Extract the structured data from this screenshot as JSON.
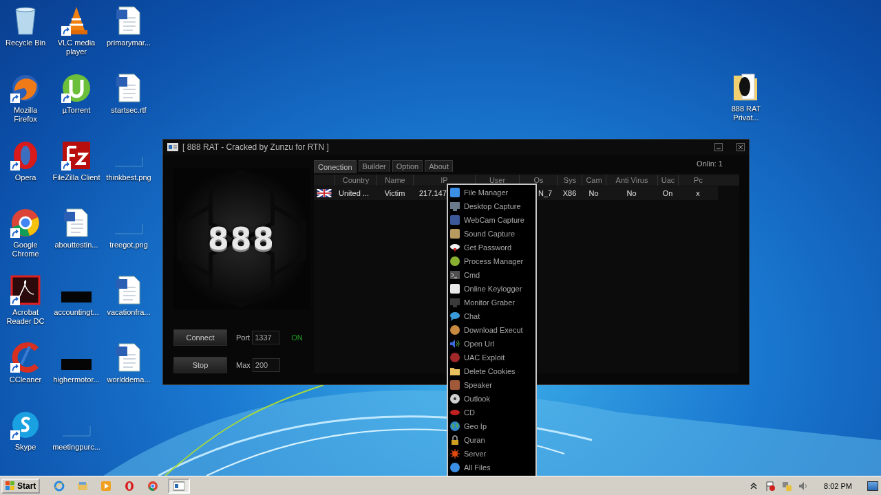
{
  "desktop_icons": [
    {
      "label": "Recycle Bin",
      "kind": "recycle",
      "shortcut": false
    },
    {
      "label": "Mozilla Firefox",
      "kind": "firefox",
      "shortcut": true
    },
    {
      "label": "Opera",
      "kind": "opera",
      "shortcut": true
    },
    {
      "label": "Google Chrome",
      "kind": "chrome",
      "shortcut": true
    },
    {
      "label": "Acrobat Reader DC",
      "kind": "acrobat",
      "shortcut": true
    },
    {
      "label": "CCleaner",
      "kind": "ccleaner",
      "shortcut": true
    },
    {
      "label": "Skype",
      "kind": "skype",
      "shortcut": true
    },
    {
      "label": "VLC media player",
      "kind": "vlc",
      "shortcut": true
    },
    {
      "label": "µTorrent",
      "kind": "utorrent",
      "shortcut": true
    },
    {
      "label": "FileZilla Client",
      "kind": "filezilla",
      "shortcut": true
    },
    {
      "label": "abouttestin...",
      "kind": "word",
      "shortcut": false
    },
    {
      "label": "accountingt...",
      "kind": "black",
      "shortcut": false
    },
    {
      "label": "highermotor...",
      "kind": "black",
      "shortcut": false
    },
    {
      "label": "meetingpurc...",
      "kind": "blank",
      "shortcut": false
    },
    {
      "label": "primarymar...",
      "kind": "word",
      "shortcut": false
    },
    {
      "label": "startsec.rtf",
      "kind": "word",
      "shortcut": false
    },
    {
      "label": "thinkbest.png",
      "kind": "blank",
      "shortcut": false
    },
    {
      "label": "treegot.png",
      "kind": "blank",
      "shortcut": false
    },
    {
      "label": "vacationfra...",
      "kind": "word",
      "shortcut": false
    },
    {
      "label": "worlddema...",
      "kind": "word",
      "shortcut": false
    }
  ],
  "right_icon": {
    "label": "888 RAT Privat...",
    "kind": "folder"
  },
  "window": {
    "title": "[ 888 RAT - Cracked by Zunzu for RTN ]",
    "logo": "888",
    "connect_button": "Connect",
    "stop_button": "Stop",
    "port": {
      "label": "Port",
      "value": "1337"
    },
    "max": {
      "label": "Max",
      "value": "200"
    },
    "status": "ON",
    "tabs": [
      {
        "label": "Conection",
        "selected": true
      },
      {
        "label": "Builder",
        "selected": false
      },
      {
        "label": "Option",
        "selected": false
      },
      {
        "label": "About",
        "selected": false
      }
    ],
    "online": "Onlin: 1",
    "table": {
      "columns": [
        "Country",
        "Name",
        "IP",
        "User",
        "Os",
        "Sys",
        "Cam",
        "Anti Virus",
        "Uac",
        "Pc"
      ],
      "rows": [
        {
          "country": "United ...",
          "name": "Victim",
          "ip": "217.147",
          "os": "N_7",
          "sys": "X86",
          "cam": "No",
          "antivirus": "No",
          "uac": "On",
          "pc": "x"
        }
      ]
    }
  },
  "context_menu": [
    {
      "label": "File Manager",
      "kind": "tile",
      "color": "#3a8ee6"
    },
    {
      "label": "Desktop Capture",
      "kind": "monitor",
      "color": "#6a7a88"
    },
    {
      "label": "WebCam Capture",
      "kind": "tile",
      "color": "#3b5998"
    },
    {
      "label": "Sound Capture",
      "kind": "tile",
      "color": "#b89a60"
    },
    {
      "label": "Get Password",
      "kind": "cloud",
      "color": "#f0f0f0"
    },
    {
      "label": "Process Manager",
      "kind": "circle",
      "color": "#8ab030"
    },
    {
      "label": "Cmd",
      "kind": "terminal",
      "color": "#505050"
    },
    {
      "label": "Online Keylogger",
      "kind": "tile",
      "color": "#e8e8e8"
    },
    {
      "label": "Monitor Graber",
      "kind": "monitor",
      "color": "#3a3a3a"
    },
    {
      "label": "Chat",
      "kind": "chat",
      "color": "#3a9ad9"
    },
    {
      "label": "Download Execut",
      "kind": "circle",
      "color": "#c88a40"
    },
    {
      "label": "Open Url",
      "kind": "speaker",
      "color": "#3a6ad9"
    },
    {
      "label": "UAC Exploit",
      "kind": "circle",
      "color": "#a02828"
    },
    {
      "label": "Delete Cookies",
      "kind": "folder",
      "color": "#e8c060"
    },
    {
      "label": "Speaker",
      "kind": "tile",
      "color": "#a05a3a"
    },
    {
      "label": "Outlook",
      "kind": "disc",
      "color": "#d0d0d0"
    },
    {
      "label": "CD",
      "kind": "lips",
      "color": "#c02020"
    },
    {
      "label": "Geo Ip",
      "kind": "globe",
      "color": "#2f86c8"
    },
    {
      "label": "Quran",
      "kind": "lock",
      "color": "#d0a020"
    },
    {
      "label": "Server",
      "kind": "sun",
      "color": "#e04a10"
    },
    {
      "label": "All Files",
      "kind": "circle",
      "color": "#3a8ee6"
    }
  ],
  "taskbar": {
    "start": "Start",
    "items": [
      {
        "kind": "ie",
        "selected": false
      },
      {
        "kind": "explorer",
        "selected": false
      },
      {
        "kind": "media",
        "selected": false
      },
      {
        "kind": "opera",
        "selected": false
      },
      {
        "kind": "chrome",
        "selected": false
      },
      {
        "kind": "app",
        "selected": true
      }
    ],
    "tray": [
      {
        "kind": "chevron"
      },
      {
        "kind": "flag"
      },
      {
        "kind": "network"
      },
      {
        "kind": "volume"
      }
    ],
    "clock": "8:02 PM"
  }
}
